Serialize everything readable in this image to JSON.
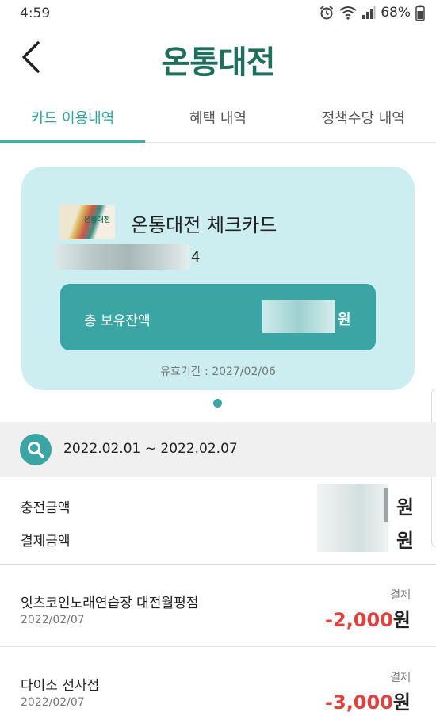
{
  "status": {
    "time": "4:59",
    "battery": "68%"
  },
  "header": {
    "logo": "온통대전"
  },
  "tabs": [
    {
      "label": "카드 이용내역",
      "active": true
    },
    {
      "label": "혜택 내역",
      "active": false
    },
    {
      "label": "정책수당 내역",
      "active": false
    }
  ],
  "card": {
    "thumb_text": "온통대전",
    "name": "온통대전 체크카드",
    "number_last_digit": "4",
    "balance_label": "총 보유잔액",
    "balance_unit": "원",
    "validity": "유효기간 : 2027/02/06"
  },
  "search": {
    "date_range": "2022.02.01 ~ 2022.02.07"
  },
  "summary": {
    "charge_label": "충전금액",
    "charge_unit": "원",
    "payment_label": "결제금액",
    "payment_unit": "원"
  },
  "transactions": [
    {
      "name": "잇츠코인노래연습장 대전월평점",
      "date": "2022/02/07",
      "type": "결제",
      "amount": "-2,000",
      "unit": "원"
    },
    {
      "name": "다이소 선사점",
      "date": "2022/02/07",
      "type": "결제",
      "amount": "-3,000",
      "unit": "원"
    }
  ],
  "colors": {
    "accent": "#3aa5a2",
    "card_bg": "#cdeef0",
    "negative": "#e0413c"
  }
}
